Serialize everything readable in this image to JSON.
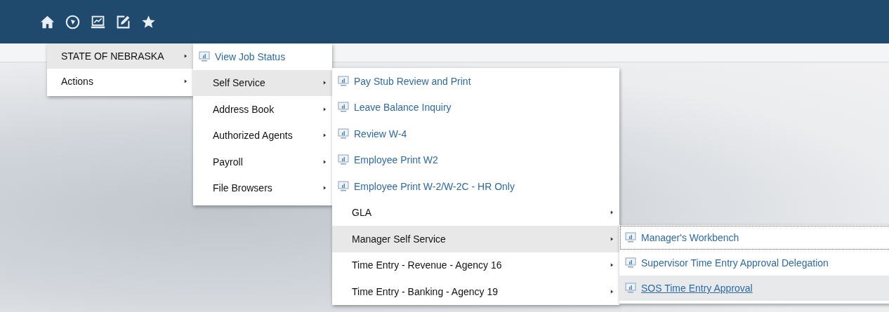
{
  "toolbar": {
    "icons": [
      {
        "kind": "home"
      },
      {
        "kind": "compass"
      },
      {
        "kind": "laptop"
      },
      {
        "kind": "edit"
      },
      {
        "kind": "star"
      }
    ]
  },
  "menus": [
    {
      "items": [
        {
          "label": "STATE OF NEBRASKA",
          "kind": "submenu",
          "selected": true
        },
        {
          "label": "Actions",
          "kind": "submenu",
          "selected": false
        }
      ]
    },
    {
      "items": [
        {
          "label": "View Job Status",
          "kind": "link",
          "selected": false
        },
        {
          "label": "Self Service",
          "kind": "submenu",
          "selected": true
        },
        {
          "label": "Address Book",
          "kind": "submenu",
          "selected": false
        },
        {
          "label": "Authorized Agents",
          "kind": "submenu",
          "selected": false
        },
        {
          "label": "Payroll",
          "kind": "submenu",
          "selected": false
        },
        {
          "label": "File Browsers",
          "kind": "submenu",
          "selected": false
        }
      ]
    },
    {
      "items": [
        {
          "label": "Pay Stub Review and Print",
          "kind": "link",
          "selected": false
        },
        {
          "label": "Leave Balance Inquiry",
          "kind": "link",
          "selected": false
        },
        {
          "label": "Review W-4",
          "kind": "link",
          "selected": false
        },
        {
          "label": "Employee Print W2",
          "kind": "link",
          "selected": false
        },
        {
          "label": "Employee Print W-2/W-2C - HR Only",
          "kind": "link",
          "selected": false
        },
        {
          "label": "GLA",
          "kind": "submenu",
          "selected": false
        },
        {
          "label": "Manager Self Service",
          "kind": "submenu",
          "selected": true
        },
        {
          "label": "Time Entry - Revenue - Agency 16",
          "kind": "submenu",
          "selected": false
        },
        {
          "label": "Time Entry - Banking - Agency 19",
          "kind": "submenu",
          "selected": false
        }
      ]
    },
    {
      "items": [
        {
          "label": "Manager's Workbench",
          "kind": "link",
          "focused": true,
          "hovered": false
        },
        {
          "label": "Supervisor Time Entry Approval Delegation",
          "kind": "link",
          "focused": false,
          "hovered": false
        },
        {
          "label": "SOS Time Entry Approval",
          "kind": "link",
          "focused": false,
          "hovered": true
        }
      ]
    }
  ]
}
